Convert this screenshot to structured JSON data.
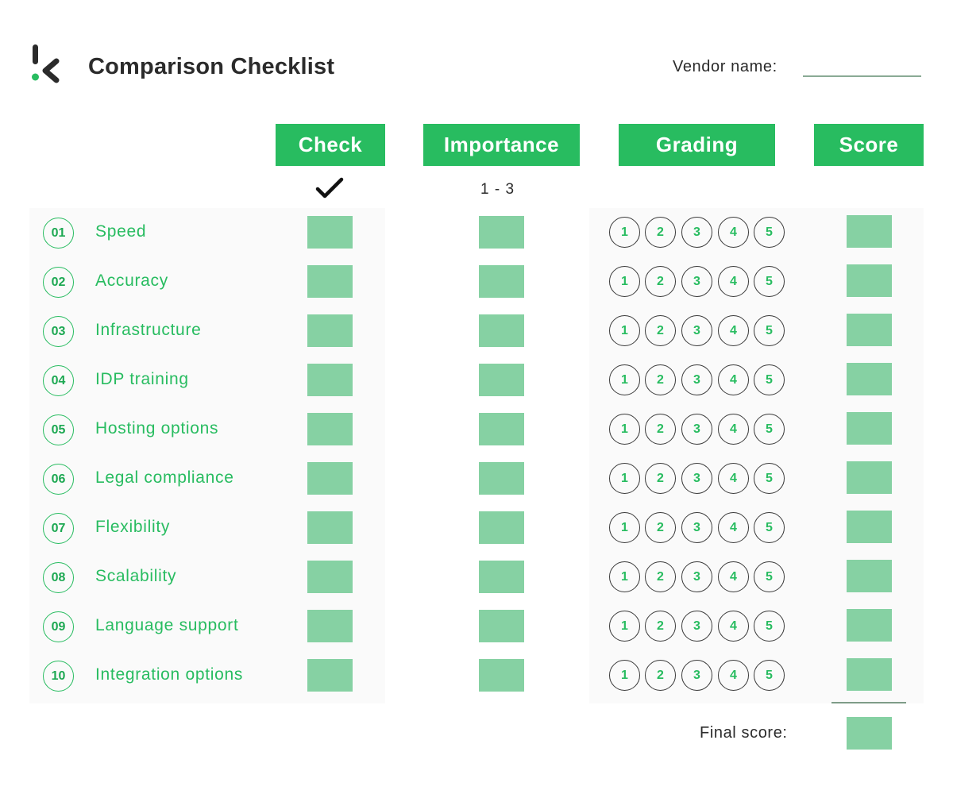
{
  "header": {
    "logo_icon": "k-logo-icon",
    "title": "Comparison Checklist",
    "vendor_label": "Vendor name:",
    "vendor_value": ""
  },
  "columns": {
    "check": "Check",
    "importance": "Importance",
    "grading": "Grading",
    "score": "Score"
  },
  "subheaders": {
    "check_icon": "checkmark-icon",
    "importance_range": "1 - 3"
  },
  "grade_options": [
    "1",
    "2",
    "3",
    "4",
    "5"
  ],
  "criteria": [
    {
      "number": "01",
      "label": "Speed"
    },
    {
      "number": "02",
      "label": "Accuracy"
    },
    {
      "number": "03",
      "label": "Infrastructure"
    },
    {
      "number": "04",
      "label": "IDP training"
    },
    {
      "number": "05",
      "label": "Hosting options"
    },
    {
      "number": "06",
      "label": "Legal compliance"
    },
    {
      "number": "07",
      "label": "Flexibility"
    },
    {
      "number": "08",
      "label": "Scalability"
    },
    {
      "number": "09",
      "label": "Language support"
    },
    {
      "number": "10",
      "label": "Integration options"
    }
  ],
  "footer": {
    "final_score_label": "Final score:"
  },
  "colors": {
    "accent": "#28bc60",
    "box_fill": "#86d1a3",
    "text_dark": "#2b2b2b",
    "panel_bg": "#fafafa"
  }
}
